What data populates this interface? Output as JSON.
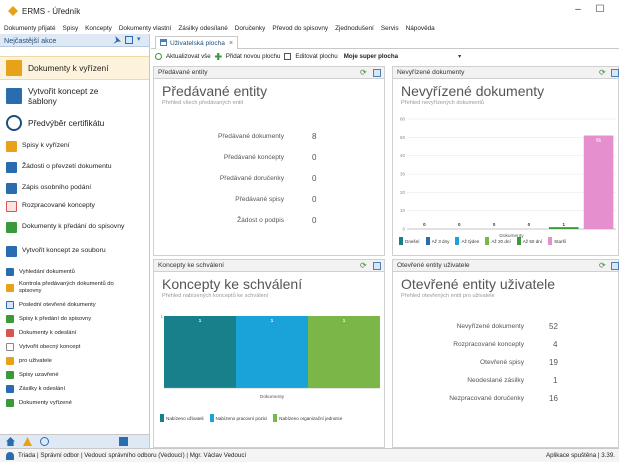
{
  "window": {
    "title": "ERMS - Úředník",
    "minimize": "–",
    "maximize": "☐"
  },
  "menu": [
    "Dokumenty přijaté",
    "Spisy",
    "Koncepty",
    "Dokumenty vlastní",
    "Zásilky odesílané",
    "Doručenky",
    "Převod do spisovny",
    "Zjednodušení",
    "Servis",
    "Nápověda"
  ],
  "sidebar": {
    "header": "Nejčastější akce",
    "items": [
      {
        "label": "Dokumenty k vyřízení",
        "icon": "folder-icon",
        "color": "#e8a21a"
      },
      {
        "label": "Vytvořit koncept ze šablony",
        "icon": "template-icon",
        "color": "#2a6cb0"
      },
      {
        "label": "Předvýběr certifikátu",
        "icon": "certificate-icon",
        "color": "#1f4e79"
      },
      {
        "label": "Spisy k vyřízení",
        "icon": "file-folder-icon",
        "color": "#e8a21a"
      },
      {
        "label": "Žádosti o převzetí dokumentu",
        "icon": "request-icon",
        "color": "#2a6cb0"
      },
      {
        "label": "Zápis osobního podání",
        "icon": "person-icon",
        "color": "#2a6cb0"
      },
      {
        "label": "Rozpracované koncepty",
        "icon": "draft-icon",
        "color": "#d9534f"
      },
      {
        "label": "Dokumenty k předání do spisovny",
        "icon": "arrow-right-icon",
        "color": "#3a9a3a"
      },
      {
        "label": "Vytvořit koncept ze souboru",
        "icon": "file-icon",
        "color": "#2a6cb0"
      },
      {
        "label": "Vyhledání dokumentů",
        "icon": "search-doc-icon",
        "color": "#2a6cb0"
      },
      {
        "label": "Kontrola předávaných dokumentů do spisovny",
        "icon": "check-icon",
        "color": "#e8a21a"
      },
      {
        "label": "Poslední otevřené dokumenty",
        "icon": "recent-icon",
        "color": "#2a6cb0"
      },
      {
        "label": "Spisy k předání do spisovny",
        "icon": "archive-icon",
        "color": "#3a9a3a"
      },
      {
        "label": "Dokumenty k odeslání",
        "icon": "send-icon",
        "color": "#d9534f"
      },
      {
        "label": "Vytvořit obecný koncept",
        "icon": "new-doc-icon",
        "color": "#ffffff"
      },
      {
        "label": "pro uživatele",
        "icon": "user-folder-icon",
        "color": "#e8a21a"
      },
      {
        "label": "Spisy uzavřené",
        "icon": "closed-icon",
        "color": "#3a9a3a"
      },
      {
        "label": "Zásilky k odeslání",
        "icon": "package-icon",
        "color": "#2a6cb0"
      },
      {
        "label": "Dokumenty vyřízené",
        "icon": "done-icon",
        "color": "#3a9a3a"
      }
    ]
  },
  "tabs": [
    {
      "label": "Uživatelská plocha",
      "close": "×"
    }
  ],
  "toolbar": {
    "refresh_label": "Aktualizovat vše",
    "add_label": "Přidat novou plochu",
    "edit_label": "Editovat plochu",
    "board_value": "Moje super plocha"
  },
  "panels": {
    "handed": {
      "header": "Předávané entity",
      "title": "Předávané entity",
      "subtitle": "Přehled všech předávaných entit",
      "rows": [
        {
          "label": "Předávané dokumenty",
          "value": "8"
        },
        {
          "label": "Předávané koncepty",
          "value": "0"
        },
        {
          "label": "Předávané doručenky",
          "value": "0"
        },
        {
          "label": "Předávané spisy",
          "value": "0"
        },
        {
          "label": "Žádost o podpis",
          "value": "0"
        }
      ]
    },
    "unhandled": {
      "header": "Nevyřízené dokumenty",
      "title": "Nevyřízené dokumenty",
      "subtitle": "Přehled nevyřízených dokumentů"
    },
    "approval": {
      "header": "Koncepty ke schválení",
      "title": "Koncepty ke schválení",
      "subtitle": "Přehled nabízených konceptů ke schválení"
    },
    "opened": {
      "header": "Otevřené entity uživatele",
      "title": "Otevřené entity uživatele",
      "subtitle": "Přehled otevřených entit pro uživatele",
      "rows": [
        {
          "label": "Nevyřízené dokumenty",
          "value": "52"
        },
        {
          "label": "Rozpracované koncepty",
          "value": "4"
        },
        {
          "label": "Otevřené spisy",
          "value": "19"
        },
        {
          "label": "Neodeslané zásilky",
          "value": "1"
        },
        {
          "label": "Nezpracované doručenky",
          "value": "16"
        }
      ]
    }
  },
  "chart_data": [
    {
      "type": "bar",
      "xlabel": "Dokumenty",
      "ylim": [
        0,
        60
      ],
      "yticks": [
        "60",
        "50",
        "40",
        "30",
        "20",
        "10",
        "0"
      ],
      "series": [
        {
          "name": "Dnešní",
          "values": [
            0
          ],
          "color": "#17808a"
        },
        {
          "name": "Až 3 dny",
          "values": [
            0
          ],
          "color": "#2a6cb0"
        },
        {
          "name": "Až týden",
          "values": [
            0
          ],
          "color": "#1aa3d9"
        },
        {
          "name": "Až 20 dní",
          "values": [
            0
          ],
          "color": "#7ab648"
        },
        {
          "name": "Až 50 dní",
          "values": [
            1
          ],
          "color": "#3a9a3a"
        },
        {
          "name": "Starší",
          "values": [
            51
          ],
          "color": "#e58fcf"
        }
      ]
    },
    {
      "type": "bar",
      "xlabel": "Dokumenty",
      "series": [
        {
          "name": "Nabízeno uživateli",
          "values": [
            1
          ],
          "color": "#17808a"
        },
        {
          "name": "Nabízeno pracovní pozici",
          "values": [
            1
          ],
          "color": "#1aa3d9"
        },
        {
          "name": "Nabízeno organizační jednotce",
          "values": [
            1
          ],
          "color": "#7ab648"
        }
      ]
    }
  ],
  "statusbar": {
    "user": "Triada | Správní odbor | Vedoucí správního odboru (Vedoucí) | Mgr. Václav Vedoucí",
    "status": "Aplikace spuštěna | 3.39."
  }
}
